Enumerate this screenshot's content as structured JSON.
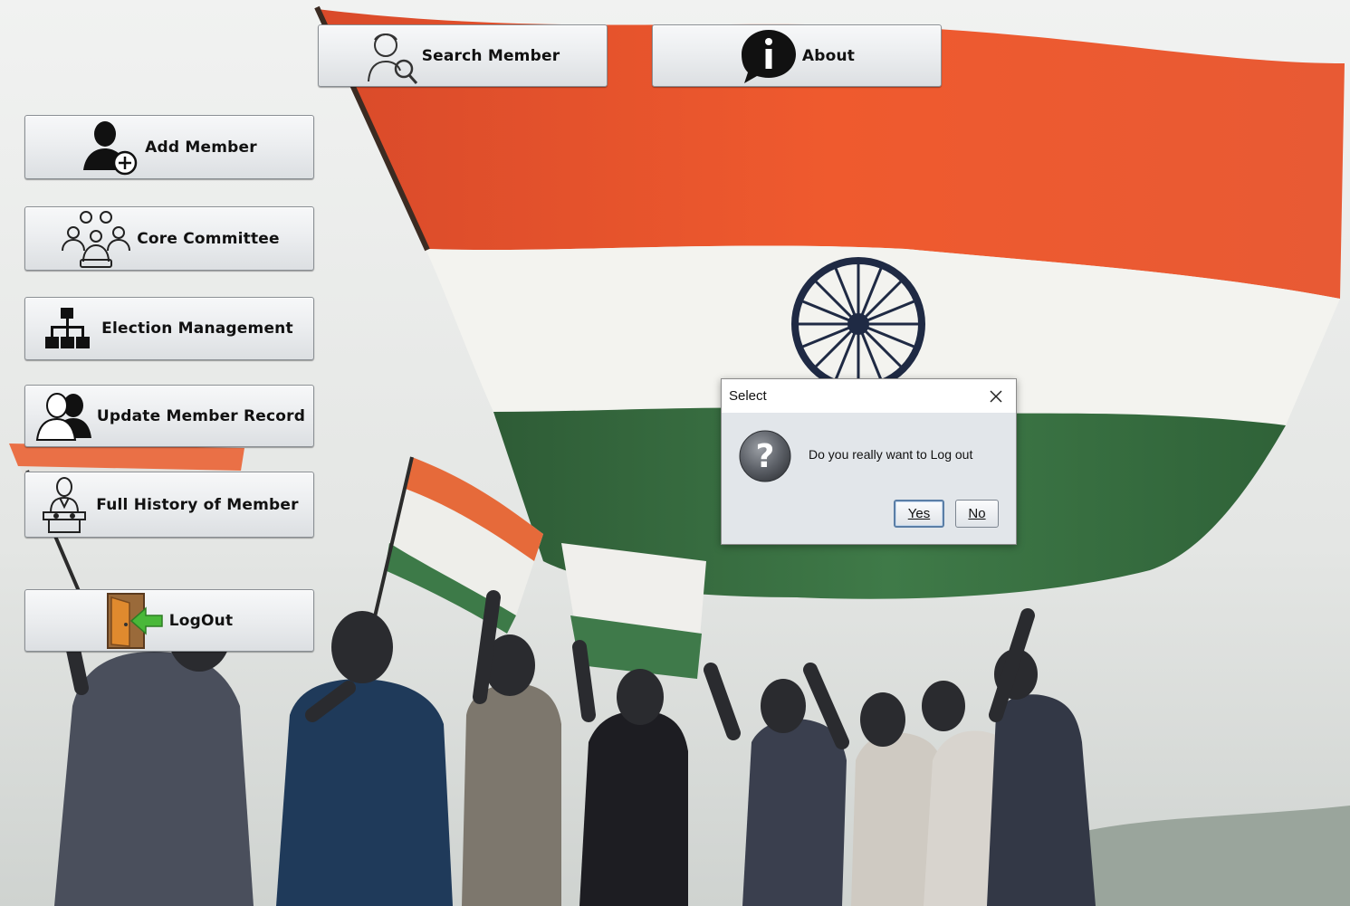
{
  "window": {
    "background_scene": "crowd waving indian flags"
  },
  "buttons": {
    "search_member": {
      "label": "Search Member",
      "icon": "person-search-icon"
    },
    "about": {
      "label": "About",
      "icon": "info-bubble-icon"
    },
    "add_member": {
      "label": "Add Member",
      "icon": "add-user-icon"
    },
    "core_committee": {
      "label": "Core Committee",
      "icon": "group-icon"
    },
    "election_management": {
      "label": "Election Management",
      "icon": "hierarchy-icon"
    },
    "update_member_record": {
      "label": "Update Member Record",
      "icon": "users-icon"
    },
    "full_history": {
      "label": "Full History of Member",
      "icon": "speaker-podium-icon"
    },
    "logout": {
      "label": "LogOut",
      "icon": "exit-door-icon"
    }
  },
  "dialog": {
    "title": "Select",
    "message": "Do you really want to Log out",
    "yes_label": "Yes",
    "no_label": "No",
    "icon": "question-icon"
  },
  "colors": {
    "saffron": "#e8572a",
    "white": "#f4f4f0",
    "green": "#3c7a45",
    "chakra": "#1f2a44"
  }
}
